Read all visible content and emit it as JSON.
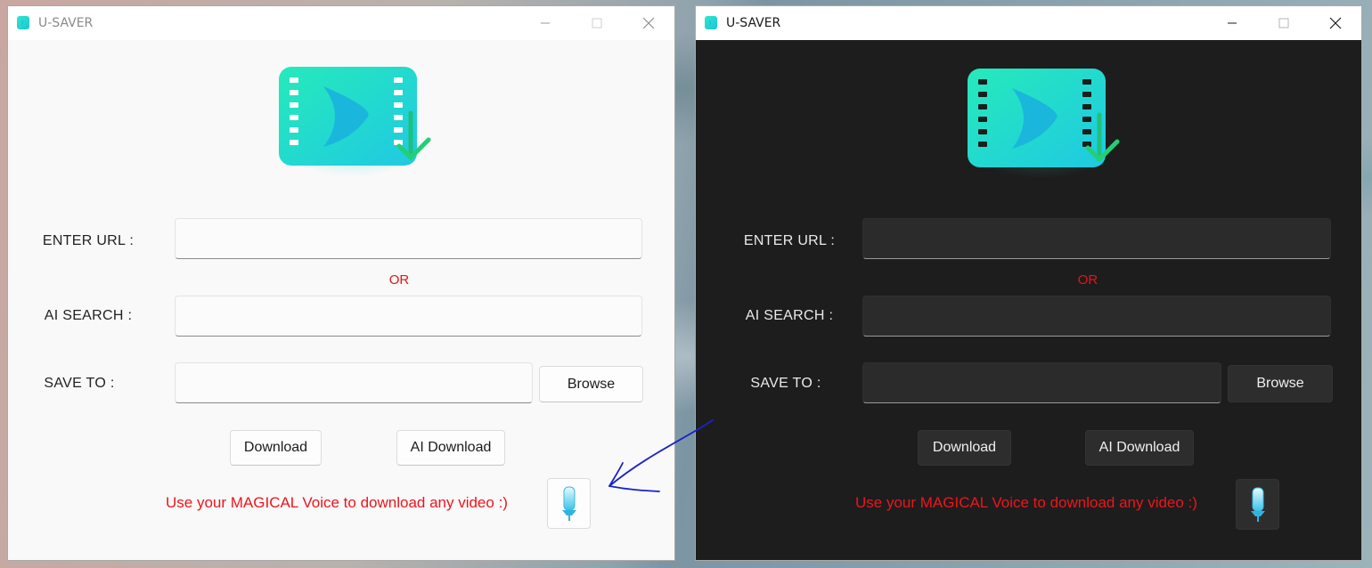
{
  "windows": {
    "light": {
      "title": "U-SAVER",
      "url_label": "ENTER URL :",
      "or_label": "OR",
      "ai_search_label": "AI SEARCH :",
      "save_to_label": "SAVE TO :",
      "url_value": "",
      "ai_search_value": "",
      "save_to_value": "",
      "browse_label": "Browse",
      "download_label": "Download",
      "ai_download_label": "AI Download",
      "voice_prompt": "Use your MAGICAL Voice to download any video :)"
    },
    "dark": {
      "title": "U-SAVER",
      "url_label": "ENTER URL :",
      "or_label": "OR",
      "ai_search_label": "AI SEARCH :",
      "save_to_label": "SAVE TO :",
      "url_value": "",
      "ai_search_value": "",
      "save_to_value": "",
      "browse_label": "Browse",
      "download_label": "Download",
      "ai_download_label": "AI Download",
      "voice_prompt": "Use your MAGICAL Voice to download any video :)"
    }
  },
  "icons": {
    "app_logo": "video-download-icon",
    "microphone": "microphone-icon",
    "annotation": "hand-drawn-arrow"
  },
  "colors": {
    "accent_teal": "#1fd6c9",
    "accent_green": "#26c77a",
    "warning_red": "#f0141b",
    "light_bg": "#f9f9f9",
    "dark_bg": "#1d1d1d",
    "arrow_blue": "#1a22c8"
  }
}
